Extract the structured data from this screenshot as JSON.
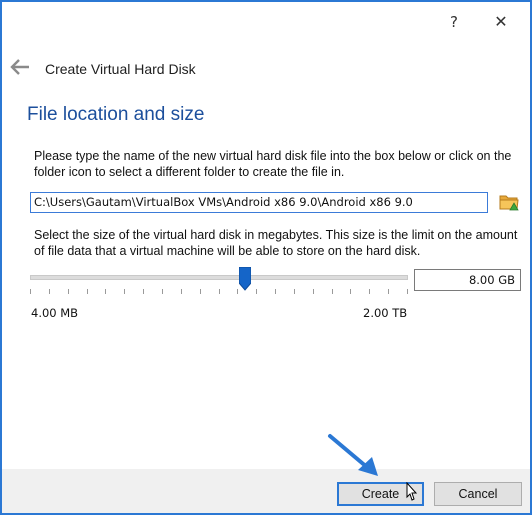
{
  "titlebar": {
    "help_glyph": "?",
    "close_glyph": "✕"
  },
  "wizard": {
    "title": "Create Virtual Hard Disk"
  },
  "section": {
    "title": "File location and size"
  },
  "location": {
    "description": "Please type the name of the new virtual hard disk file into the box below or click on the folder icon to select a different folder to create the file in.",
    "path_value": "C:\\Users\\Gautam\\VirtualBox VMs\\Android x86 9.0\\Android x86 9.0"
  },
  "size": {
    "description": "Select the size of the virtual hard disk in megabytes. This size is the limit on the amount of file data that a virtual machine will be able to store on the hard disk.",
    "value": "8.00 GB",
    "min_label": "4.00 MB",
    "max_label": "2.00 TB",
    "slider_fraction": 0.57
  },
  "buttons": {
    "create": "Create",
    "cancel": "Cancel"
  },
  "colors": {
    "accent": "#2b78d4",
    "section_title": "#1c4f9c",
    "annotation_arrow": "#2b78d4"
  }
}
